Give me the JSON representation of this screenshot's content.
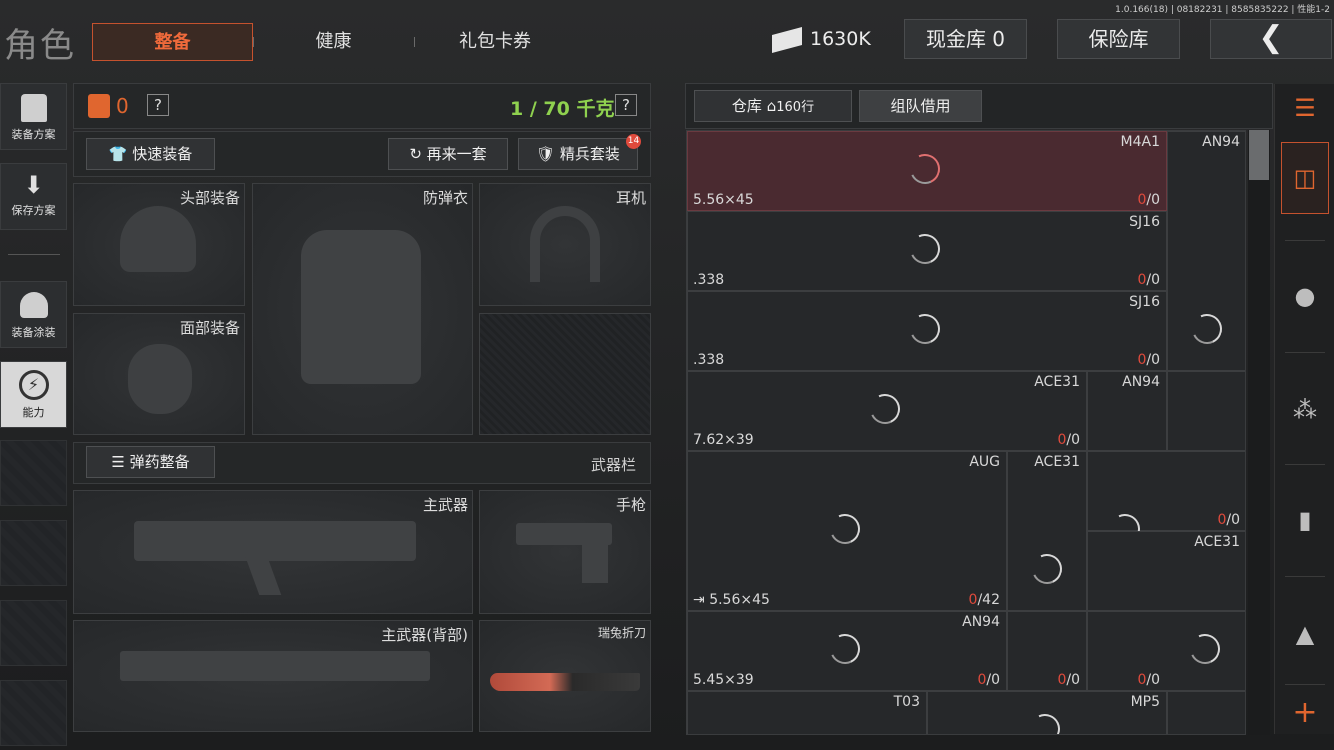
{
  "version": "1.0.166(18) | 08182231 | 8585835222 | 性能1-2",
  "header": {
    "title": "角色",
    "tabs": [
      "整备",
      "健康",
      "礼包卡券"
    ],
    "currency": "1630K",
    "cash_vault": "现金库 0",
    "safe": "保险库",
    "back_icon": "chevron-left-icon"
  },
  "sidebar": {
    "items": [
      {
        "label": "装备方案",
        "icon": "vest-icon"
      },
      {
        "label": "保存方案",
        "icon": "download-icon"
      },
      {
        "label": "装备涂装",
        "icon": "helmet-paint-icon"
      },
      {
        "label": "能力",
        "icon": "ability-icon"
      }
    ]
  },
  "gear": {
    "armor_count": "0",
    "help": "?",
    "weight": "1 / 70 千克",
    "quick_equip": "快速装备",
    "again": "再来一套",
    "elite": "精兵套装",
    "elite_badge": "14",
    "slots": {
      "head": "头部装备",
      "body": "防弹衣",
      "ear": "耳机",
      "face": "面部装备"
    },
    "ammo_button": "弹药整备",
    "weapon_bar": "武器栏",
    "weapons": {
      "primary": "主武器",
      "pistol": "手枪",
      "primary_back": "主武器(背部)",
      "knife": "瑞兔折刀"
    }
  },
  "storage": {
    "warehouse": "仓库",
    "rows": "160行",
    "team_borrow": "组队借用",
    "cells": [
      {
        "name": "M4A1",
        "caliber": "5.56×45",
        "count_red": "0",
        "count_rest": "/0"
      },
      {
        "name": "AN94"
      },
      {
        "name": "SJ16",
        "caliber": ".338",
        "count_red": "0",
        "count_rest": "/0"
      },
      {
        "name": "SJ16",
        "caliber": ".338",
        "count_red": "0",
        "count_rest": "/0"
      },
      {
        "name": "ACE31",
        "count_red": "0",
        "count_rest": "/0"
      },
      {
        "name": "AN94"
      },
      {
        "caliber": "7.62×39"
      },
      {
        "name": "AUG"
      },
      {
        "name": "ACE31"
      },
      {
        "count_red": "0",
        "count_rest": "/0"
      },
      {
        "name": "ACE31"
      },
      {
        "caliber": "5.56×45",
        "count_red": "0",
        "count_rest": "/42"
      },
      {
        "name": "AN94",
        "count_red": "0",
        "count_rest": "/0"
      },
      {
        "count_red": "0",
        "count_rest": "/0"
      },
      {
        "count_red": "0",
        "count_rest": "/0"
      },
      {
        "caliber": "5.45×39"
      },
      {
        "name": "T03"
      },
      {
        "name": "MP5"
      }
    ]
  },
  "right_bar": {
    "icons": [
      "layers-refresh-icon",
      "stack-icon",
      "helmet-icon",
      "rifle-icon",
      "magazine-icon",
      "ammo-icon",
      "plus-icon"
    ]
  },
  "colors": {
    "accent": "#f06a3b",
    "green": "#8fd14f",
    "red": "#e04a3c"
  }
}
